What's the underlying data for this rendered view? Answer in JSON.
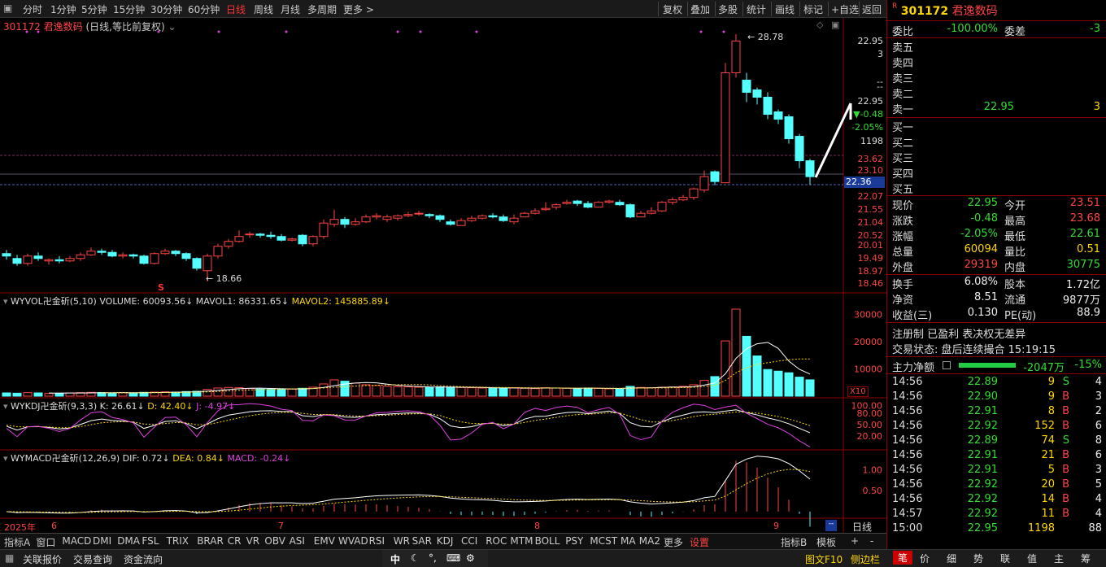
{
  "toolbar": {
    "periods": [
      "分时",
      "1分钟",
      "5分钟",
      "15分钟",
      "30分钟",
      "60分钟",
      "日线",
      "周线",
      "月线",
      "多周期",
      "更多 >"
    ],
    "right": [
      "复权",
      "叠加",
      "多股",
      "统计",
      "画线",
      "标记",
      "+自选",
      "返回"
    ]
  },
  "chart": {
    "title_code": "301172",
    "title_name": "君逸数码",
    "title_mode": "(日线,等比前复权)",
    "high_label": "28.78",
    "low_label": "18.66",
    "low_marker": "S",
    "current_price_tag": "22.36",
    "price_axis": [
      "22.95",
      "3",
      "--",
      "--",
      "22.95",
      "▼-0.48",
      "-2.05%",
      "1198",
      "23.62",
      "23.10",
      "22.07",
      "21.55",
      "21.04",
      "20.52",
      "20.01",
      "19.49",
      "18.97",
      "18.46"
    ],
    "vol_header": {
      "name": "WYVOL卍金斫(5,10)",
      "vol": "VOLUME: 60093.56↓",
      "m1": "MAVOL1: 86331.65↓",
      "m2": "MAVOL2: 145885.89↓"
    },
    "vol_axis": [
      "30000",
      "20000",
      "10000"
    ],
    "vol_unit": "X10",
    "kdj_header": {
      "name": "WYKDJ卍金斫(9,3,3)",
      "k": "K: 26.61↓",
      "d": "D: 42.40↓",
      "j": "J: -4.97↓"
    },
    "kdj_axis": [
      "100.00",
      "80.00",
      "50.00",
      "20.00"
    ],
    "macd_header": {
      "name": "WYMACD卍金斫(12,26,9)",
      "dif": "DIF: 0.72↓",
      "dea": "DEA: 0.84↓",
      "macd": "MACD: -0.24↓"
    },
    "macd_axis": [
      "1.00",
      "0.50"
    ],
    "date_axis": [
      "2025年",
      "6",
      "7",
      "8",
      "9"
    ],
    "period_label": "日线"
  },
  "chart_data": {
    "type": "candlestick",
    "candles": [
      [
        19.8,
        19.7,
        19.95,
        19.55
      ],
      [
        19.6,
        19.4,
        19.75,
        19.3
      ],
      [
        19.4,
        19.7,
        19.8,
        19.3
      ],
      [
        19.7,
        19.6,
        19.85,
        19.5
      ],
      [
        19.5,
        19.55,
        19.6,
        19.35
      ],
      [
        19.55,
        19.5,
        19.7,
        19.4
      ],
      [
        19.5,
        19.6,
        19.7,
        19.45
      ],
      [
        19.6,
        19.75,
        19.85,
        19.5
      ],
      [
        19.75,
        19.9,
        20.05,
        19.7
      ],
      [
        19.9,
        19.85,
        20.0,
        19.75
      ],
      [
        19.85,
        19.7,
        19.95,
        19.65
      ],
      [
        19.7,
        19.75,
        19.85,
        19.6
      ],
      [
        19.75,
        19.7,
        19.8,
        19.6
      ],
      [
        19.7,
        19.4,
        19.75,
        19.35
      ],
      [
        19.4,
        19.8,
        19.85,
        19.35
      ],
      [
        19.8,
        19.9,
        20.0,
        19.75
      ],
      [
        19.9,
        19.8,
        19.95,
        19.7
      ],
      [
        19.8,
        19.6,
        19.85,
        19.5
      ],
      [
        19.6,
        19.2,
        19.65,
        19.1
      ],
      [
        19.1,
        19.7,
        19.8,
        18.66
      ],
      [
        19.7,
        20.1,
        20.2,
        19.6
      ],
      [
        20.1,
        20.3,
        20.4,
        20.0
      ],
      [
        20.3,
        20.5,
        20.75,
        20.25
      ],
      [
        20.6,
        20.6,
        20.7,
        20.45
      ],
      [
        20.6,
        20.55,
        20.65,
        20.45
      ],
      [
        20.55,
        20.5,
        20.7,
        20.4
      ],
      [
        20.5,
        20.35,
        20.6,
        20.3
      ],
      [
        20.35,
        20.4,
        20.45,
        20.3
      ],
      [
        20.55,
        20.2,
        20.6,
        20.1
      ],
      [
        20.2,
        20.5,
        20.55,
        20.1
      ],
      [
        20.5,
        21.05,
        21.2,
        20.4
      ],
      [
        21.0,
        21.2,
        21.6,
        20.9
      ],
      [
        21.2,
        21.0,
        21.3,
        20.85
      ],
      [
        21.0,
        21.1,
        21.25,
        20.95
      ],
      [
        21.1,
        21.3,
        21.4,
        21.05
      ],
      [
        21.3,
        21.35,
        21.45,
        21.2
      ],
      [
        21.2,
        21.3,
        21.4,
        21.1
      ],
      [
        21.25,
        21.35,
        21.4,
        21.15
      ],
      [
        21.35,
        21.4,
        21.5,
        21.3
      ],
      [
        21.45,
        21.45,
        21.55,
        21.35
      ],
      [
        21.4,
        21.35,
        21.45,
        21.25
      ],
      [
        21.35,
        21.2,
        21.4,
        21.1
      ],
      [
        21.1,
        21.0,
        21.2,
        20.95
      ],
      [
        20.95,
        21.15,
        21.25,
        20.95
      ],
      [
        21.15,
        21.25,
        21.35,
        21.1
      ],
      [
        21.25,
        21.35,
        21.4,
        21.2
      ],
      [
        21.35,
        21.3,
        21.45,
        21.25
      ],
      [
        21.3,
        21.15,
        21.4,
        21.1
      ],
      [
        21.1,
        21.25,
        21.4,
        21.0
      ],
      [
        21.3,
        21.45,
        21.5,
        21.3
      ],
      [
        21.45,
        21.55,
        21.65,
        21.4
      ],
      [
        21.6,
        21.65,
        21.9,
        21.55
      ],
      [
        21.7,
        21.8,
        21.85,
        21.6
      ],
      [
        21.85,
        21.9,
        22.0,
        21.8
      ],
      [
        21.95,
        21.85,
        22.0,
        21.75
      ],
      [
        21.85,
        21.7,
        21.95,
        21.65
      ],
      [
        21.7,
        21.9,
        21.95,
        21.7
      ],
      [
        21.9,
        21.95,
        22.0,
        21.85
      ],
      [
        21.9,
        21.8,
        22.0,
        21.75
      ],
      [
        21.8,
        21.3,
        21.85,
        21.25
      ],
      [
        21.3,
        21.45,
        21.55,
        21.3
      ],
      [
        21.45,
        21.55,
        21.7,
        21.4
      ],
      [
        21.55,
        21.9,
        21.95,
        21.5
      ],
      [
        21.9,
        22.0,
        22.1,
        21.8
      ],
      [
        22.0,
        22.1,
        22.2,
        21.95
      ],
      [
        22.1,
        22.45,
        22.5,
        22.0
      ],
      [
        22.4,
        22.95,
        23.2,
        22.3
      ],
      [
        23.15,
        22.75,
        23.2,
        22.6
      ],
      [
        22.7,
        27.2,
        27.6,
        22.7
      ],
      [
        27.2,
        28.5,
        28.78,
        27.0
      ],
      [
        26.9,
        26.4,
        27.2,
        26.0
      ],
      [
        26.5,
        26.2,
        26.6,
        25.9
      ],
      [
        26.2,
        25.5,
        26.4,
        25.3
      ],
      [
        25.6,
        25.3,
        25.7,
        25.1
      ],
      [
        25.4,
        24.5,
        25.5,
        24.3
      ],
      [
        24.6,
        23.6,
        24.7,
        23.3
      ],
      [
        23.6,
        22.95,
        23.68,
        22.61
      ]
    ],
    "volume": [
      1200,
      1100,
      1300,
      1200,
      1000,
      1100,
      1200,
      1300,
      1400,
      1300,
      1200,
      1300,
      1200,
      1400,
      1500,
      1600,
      1500,
      1700,
      1800,
      2500,
      3000,
      3200,
      3100,
      2800,
      2600,
      2500,
      2700,
      2600,
      2900,
      3300,
      4500,
      6000,
      5500,
      4800,
      4200,
      3900,
      3600,
      3500,
      3400,
      3300,
      3200,
      3400,
      3300,
      3200,
      3100,
      3000,
      2900,
      3000,
      3100,
      2900,
      2800,
      3100,
      3000,
      2900,
      2800,
      3000,
      2900,
      2700,
      2800,
      3600,
      3200,
      3100,
      3300,
      3400,
      3600,
      4200,
      5800,
      7200,
      20300,
      32000,
      22000,
      14800,
      9800,
      9200,
      8600,
      7000,
      6000
    ],
    "kdj_range": [
      0,
      100
    ],
    "macd_range": [
      -0.1,
      1.3
    ]
  },
  "right_panel": {
    "code": "301172",
    "name": "君逸数码",
    "weibi_label": "委比",
    "weibi": "-100.00%",
    "weicha_label": "委差",
    "weicha": "-3",
    "sells": [
      {
        "l": "卖五",
        "p": "",
        "v": ""
      },
      {
        "l": "卖四",
        "p": "",
        "v": ""
      },
      {
        "l": "卖三",
        "p": "",
        "v": ""
      },
      {
        "l": "卖二",
        "p": "",
        "v": ""
      },
      {
        "l": "卖一",
        "p": "22.95",
        "v": "3"
      }
    ],
    "buys": [
      {
        "l": "买一"
      },
      {
        "l": "买二"
      },
      {
        "l": "买三"
      },
      {
        "l": "买四"
      },
      {
        "l": "买五"
      }
    ],
    "quote": [
      {
        "l1": "现价",
        "v1": "22.95",
        "c1": "green",
        "l2": "今开",
        "v2": "23.51",
        "c2": "red"
      },
      {
        "l1": "涨跌",
        "v1": "-0.48",
        "c1": "green",
        "l2": "最高",
        "v2": "23.68",
        "c2": "red"
      },
      {
        "l1": "涨幅",
        "v1": "-2.05%",
        "c1": "green",
        "l2": "最低",
        "v2": "22.61",
        "c2": "green"
      },
      {
        "l1": "总量",
        "v1": "60094",
        "c1": "yellow",
        "l2": "量比",
        "v2": "0.51",
        "c2": "yellow"
      },
      {
        "l1": "外盘",
        "v1": "29319",
        "c1": "red",
        "l2": "内盘",
        "v2": "30775",
        "c2": "green"
      }
    ],
    "stats": [
      {
        "l1": "换手",
        "v1": "6.08%",
        "l2": "股本",
        "v2": "1.72亿"
      },
      {
        "l1": "净资",
        "v1": "8.51",
        "l2": "流通",
        "v2": "9877万"
      },
      {
        "l1": "收益(三)",
        "v1": "0.130",
        "l2": "PE(动)",
        "v2": "88.9"
      }
    ],
    "info1": "注册制 已盈利 表决权无差异",
    "info2": "交易状态: 盘后连续撮合 15:19:15",
    "flow_label": "主力净额",
    "flow_value": "-2047万",
    "flow_pct": "-15%",
    "ticks": [
      {
        "t": "14:56",
        "p": "22.89",
        "v": "9",
        "s": "S",
        "n": "4"
      },
      {
        "t": "14:56",
        "p": "22.90",
        "v": "9",
        "s": "B",
        "n": "3"
      },
      {
        "t": "14:56",
        "p": "22.91",
        "v": "8",
        "s": "B",
        "n": "2"
      },
      {
        "t": "14:56",
        "p": "22.92",
        "v": "152",
        "s": "B",
        "n": "6"
      },
      {
        "t": "14:56",
        "p": "22.89",
        "v": "74",
        "s": "S",
        "n": "8"
      },
      {
        "t": "14:56",
        "p": "22.91",
        "v": "21",
        "s": "B",
        "n": "6"
      },
      {
        "t": "14:56",
        "p": "22.91",
        "v": "5",
        "s": "B",
        "n": "3"
      },
      {
        "t": "14:56",
        "p": "22.92",
        "v": "20",
        "s": "B",
        "n": "5"
      },
      {
        "t": "14:56",
        "p": "22.92",
        "v": "14",
        "s": "B",
        "n": "4"
      },
      {
        "t": "14:57",
        "p": "22.92",
        "v": "11",
        "s": "B",
        "n": "4"
      },
      {
        "t": "15:00",
        "p": "22.95",
        "v": "1198",
        "s": "",
        "n": "88"
      }
    ]
  },
  "bottom_tabs": [
    "指标A",
    "窗口",
    "MACD",
    "DMI",
    "DMA",
    "FSL",
    "TRIX",
    "BRAR",
    "CR",
    "VR",
    "OBV",
    "ASI",
    "EMV",
    "WVAD",
    "RSI",
    "WR",
    "SAR",
    "KDJ",
    "CCI",
    "ROC",
    "MTM",
    "BOLL",
    "PSY",
    "MCST",
    "MA",
    "MA2",
    "更多",
    "设置"
  ],
  "bottom_right": [
    "指标B",
    "模板",
    "+",
    "-"
  ],
  "status": {
    "left": [
      "关联报价",
      "交易查询",
      "资金流向"
    ],
    "center_icons": [
      "中",
      "moon-icon",
      "dots-icon",
      "keyboard-icon",
      "gear-icon"
    ],
    "right": [
      "图文F10",
      "侧边栏"
    ]
  },
  "right_tabs": [
    "笔",
    "价",
    "细",
    "势",
    "联",
    "值",
    "主",
    "筹"
  ]
}
